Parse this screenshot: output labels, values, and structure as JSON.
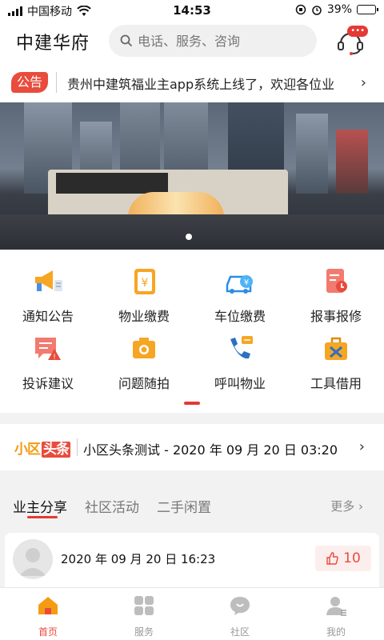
{
  "status_bar": {
    "carrier": "中国移动",
    "time": "14:53",
    "battery": "39%",
    "battery_level": 0.39
  },
  "header": {
    "title": "中建华府",
    "search_placeholder": "电话、服务、咨询",
    "service_badge": "•••"
  },
  "notice": {
    "tag": "公告",
    "text": "贵州中建筑福业主app系统上线了，欢迎各位业",
    "arrow": "›"
  },
  "banner": {
    "slides": 1,
    "active_slide": 0
  },
  "services": [
    {
      "label": "通知公告",
      "icon": "megaphone-icon"
    },
    {
      "label": "物业缴费",
      "icon": "yuan-card-icon"
    },
    {
      "label": "车位缴费",
      "icon": "car-yuan-icon"
    },
    {
      "label": "报事报修",
      "icon": "repair-report-icon"
    },
    {
      "label": "投诉建议",
      "icon": "complaint-chat-icon"
    },
    {
      "label": "问题随拍",
      "icon": "camera-icon"
    },
    {
      "label": "呼叫物业",
      "icon": "phone-call-icon"
    },
    {
      "label": "工具借用",
      "icon": "toolbox-icon"
    }
  ],
  "headline": {
    "logo_part1": "小区",
    "logo_part2": "头条",
    "text": "小区头条测试 - 2020 年 09 月 20 日 03:20",
    "arrow": "›"
  },
  "tabs": [
    {
      "label": "业主分享",
      "active": true
    },
    {
      "label": "社区活动",
      "active": false
    },
    {
      "label": "二手闲置",
      "active": false
    }
  ],
  "more_label": "更多",
  "post": {
    "time": "2020 年 09 月 20 日 16:23",
    "likes": "10"
  },
  "tabbar": [
    {
      "label": "首页",
      "icon": "home-icon",
      "active": true
    },
    {
      "label": "服务",
      "icon": "grid-icon",
      "active": false
    },
    {
      "label": "社区",
      "icon": "community-chat-icon",
      "active": false
    },
    {
      "label": "我的",
      "icon": "profile-icon",
      "active": false
    }
  ],
  "colors": {
    "accent": "#e84c3d",
    "orange": "#f39c12",
    "blue": "#2d8ce8"
  }
}
